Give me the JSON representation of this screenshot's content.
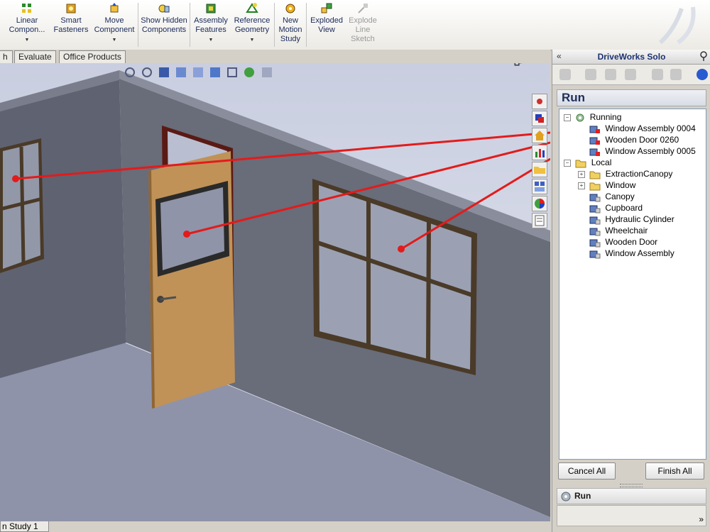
{
  "toolbar": {
    "items": [
      {
        "label": "Linear Compon...",
        "dropdown": true
      },
      {
        "label": "Smart Fasteners"
      },
      {
        "label": "Move Component",
        "dropdown": true
      },
      {
        "label": "Show Hidden Components"
      },
      {
        "label": "Assembly Features",
        "dropdown": true
      },
      {
        "label": "Reference Geometry",
        "dropdown": true
      },
      {
        "label": "New Motion Study"
      },
      {
        "label": "Exploded View"
      },
      {
        "label": "Explode Line Sketch",
        "disabled": true
      }
    ]
  },
  "tabs": [
    {
      "label": "h"
    },
    {
      "label": "Evaluate"
    },
    {
      "label": "Office Products"
    }
  ],
  "viewport": {
    "window_controls": [
      "–",
      "🗗",
      "×"
    ]
  },
  "status": {
    "motion_tab": "n Study 1"
  },
  "panel": {
    "title": "DriveWorks Solo",
    "collapse_glyph": "«",
    "section_title": "Run",
    "tree": {
      "running": {
        "label": "Running",
        "children": [
          "Window Assembly 0004",
          "Wooden Door 0260",
          "Window Assembly 0005"
        ]
      },
      "local": {
        "label": "Local",
        "folders": [
          "ExtractionCanopy",
          "Window"
        ],
        "items": [
          "Canopy",
          "Cupboard",
          "Hydraulic Cylinder",
          "Wheelchair",
          "Wooden Door",
          "Window Assembly"
        ]
      }
    },
    "cancel_all": "Cancel All",
    "finish_all": "Finish All",
    "run_bar": "Run",
    "more_glyph": "»"
  },
  "colors": {
    "accent_red": "#e31b1b",
    "wall_dark": "#5a5d6a",
    "wall_face": "#686b78",
    "door_wood": "#c09258",
    "frame_brown": "#4a3a28"
  }
}
